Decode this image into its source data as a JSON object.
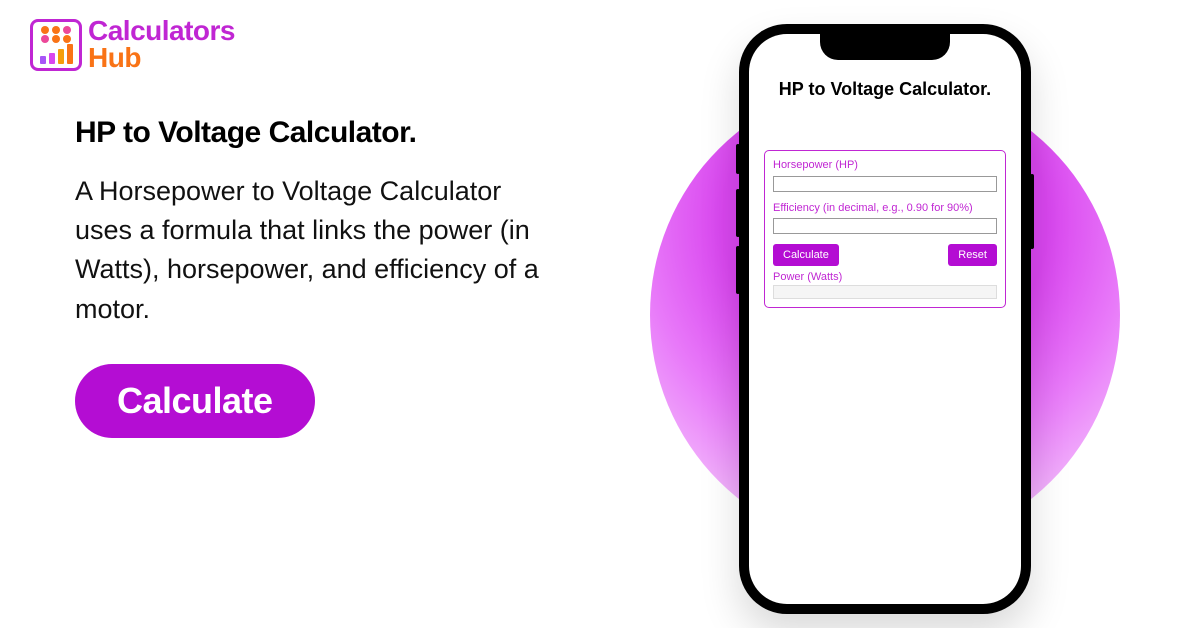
{
  "logo": {
    "line1": "Calculators",
    "line2": "Hub"
  },
  "main": {
    "title": "HP to Voltage Calculator.",
    "description": "A Horsepower to Voltage Calculator uses a formula that links the power (in Watts), horsepower, and efficiency of a motor.",
    "cta_label": "Calculate"
  },
  "app": {
    "title": "HP to Voltage Calculator.",
    "fields": {
      "hp_label": "Horsepower (HP)",
      "efficiency_label": "Efficiency (in decimal, e.g., 0.90 for 90%)",
      "output_label": "Power (Watts)"
    },
    "buttons": {
      "calculate": "Calculate",
      "reset": "Reset"
    }
  },
  "colors": {
    "brand_purple": "#b40dd3",
    "brand_orange": "#f97316",
    "accent_magenta": "#d946ef"
  }
}
